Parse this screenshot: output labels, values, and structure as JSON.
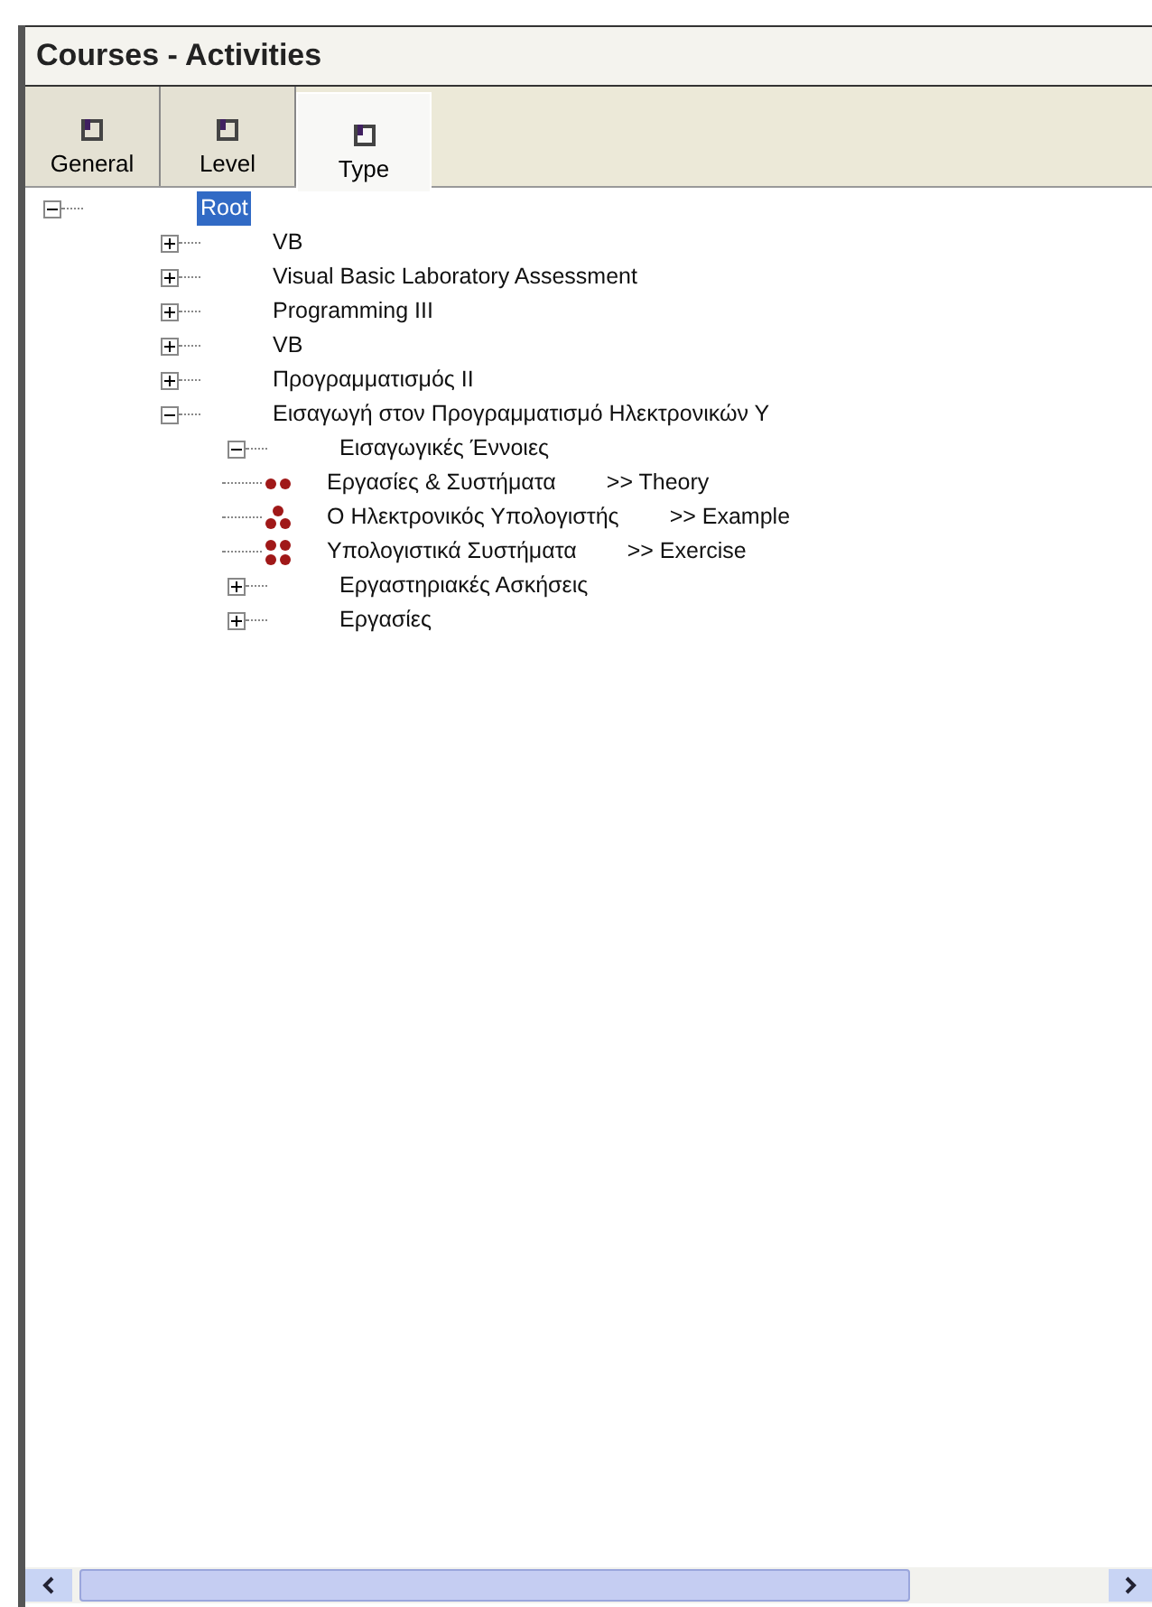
{
  "window": {
    "title": "Courses - Activities"
  },
  "tabs": [
    {
      "label": "General",
      "selected": false
    },
    {
      "label": "Level",
      "selected": false
    },
    {
      "label": "Type",
      "selected": true
    }
  ],
  "tree": [
    {
      "label": "Root",
      "selected": true,
      "expanded": true,
      "children": [
        {
          "label": "VB",
          "selected": false,
          "expanded": false
        },
        {
          "label": "Visual Basic Laboratory Assessment",
          "selected": false,
          "expanded": false
        },
        {
          "label": "Programming III",
          "selected": false,
          "expanded": false
        },
        {
          "label": "VB",
          "selected": false,
          "expanded": false
        },
        {
          "label": "Προγραμματισμός ΙΙ",
          "selected": false,
          "expanded": false
        },
        {
          "label": "Εισαγωγή στον Προγραμματισμό Ηλεκτρονικών Υ",
          "selected": false,
          "expanded": true,
          "children": [
            {
              "label": "Εισαγωγικές Έννοιες",
              "selected": false,
              "expanded": true,
              "children": [
                {
                  "kind": "theory",
                  "label": "Εργασίες & Συστήματα",
                  "tag": ">> Theory",
                  "selected": false
                },
                {
                  "kind": "example",
                  "label": "Ο Ηλεκτρονικός Υπολογιστής",
                  "tag": ">> Example",
                  "selected": false
                },
                {
                  "kind": "exercise",
                  "label": "Υπολογιστικά Συστήματα",
                  "tag": ">> Exercise",
                  "selected": false
                }
              ]
            },
            {
              "label": "Εργαστηριακές Ασκήσεις",
              "selected": false,
              "expanded": false
            },
            {
              "label": "Εργασίες",
              "selected": false,
              "expanded": false
            }
          ]
        }
      ]
    }
  ]
}
